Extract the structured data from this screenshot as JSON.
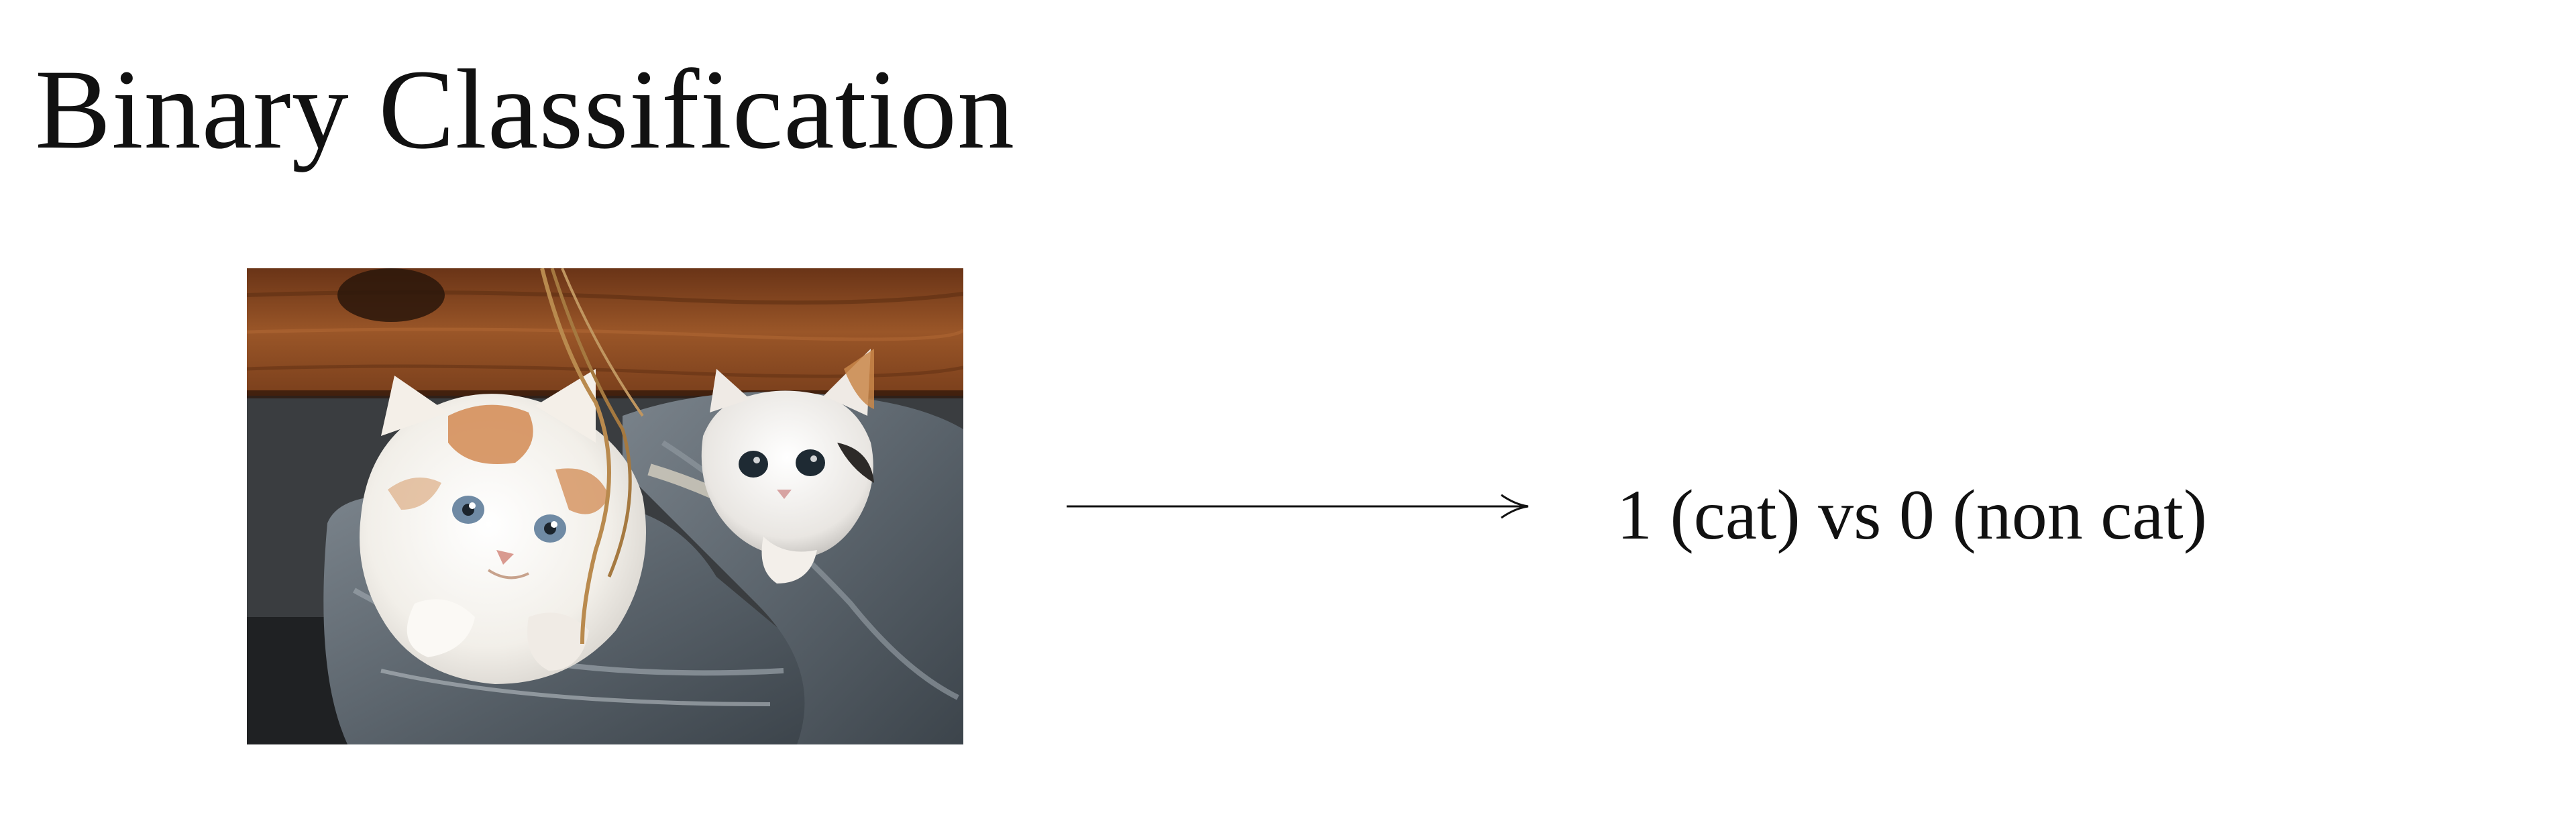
{
  "slide": {
    "title": "Binary Classification",
    "label": "1 (cat) vs 0 (non cat)"
  },
  "photo": {
    "subject": "two kittens in a grey shoe",
    "colors": {
      "wood": "#8a4a24",
      "shoe": "#5f6870",
      "fur": "#f4f1ec",
      "fur_orange": "#d28a52"
    }
  },
  "arrow": {
    "icon": "right-arrow-icon"
  }
}
